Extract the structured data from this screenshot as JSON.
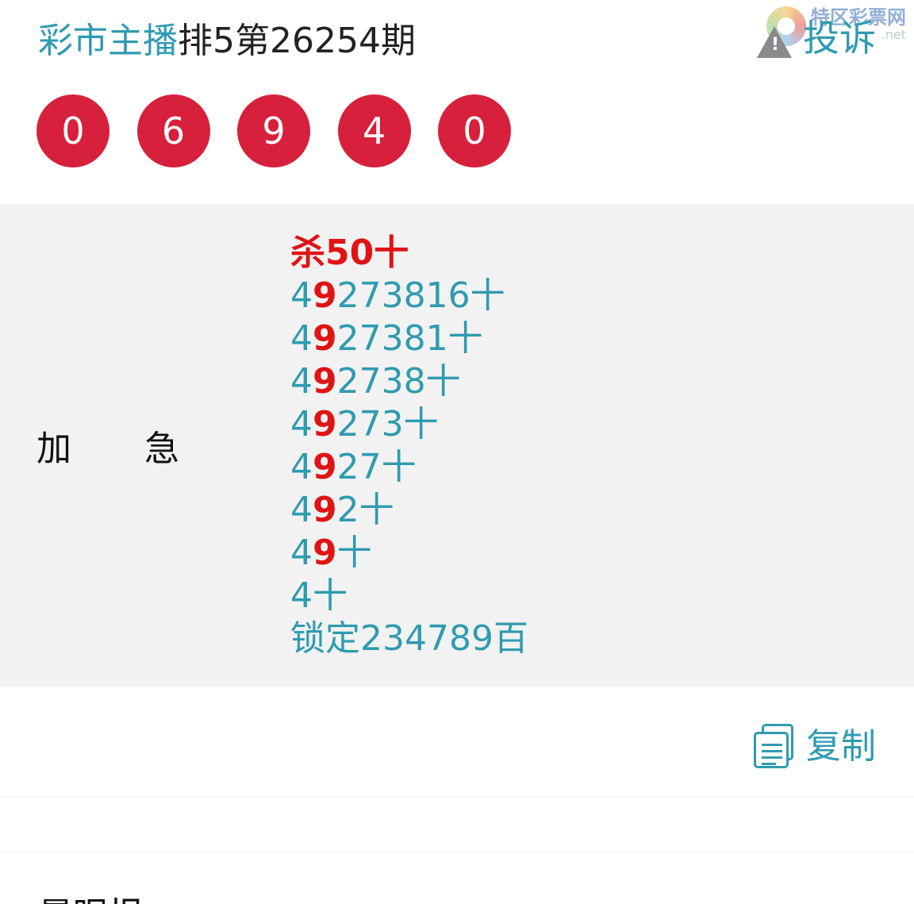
{
  "header": {
    "author": "彩市主播",
    "issue": "排5第26254期"
  },
  "complaint": {
    "icon": "warning-icon",
    "icon_glyph": "!",
    "label": "投诉"
  },
  "watermark": {
    "name": "特区彩票网",
    "url": ".net"
  },
  "balls": [
    "0",
    "6",
    "9",
    "4",
    "0"
  ],
  "panel": {
    "label_chars": [
      "加",
      "急"
    ],
    "kill_line": "杀50十",
    "lines": [
      {
        "a": "4",
        "b": "9",
        "c": "273816十"
      },
      {
        "a": "4",
        "b": "9",
        "c": "27381十"
      },
      {
        "a": "4",
        "b": "9",
        "c": "2738十"
      },
      {
        "a": "4",
        "b": "9",
        "c": "273十"
      },
      {
        "a": "4",
        "b": "9",
        "c": "27十"
      },
      {
        "a": "4",
        "b": "9",
        "c": "2十"
      },
      {
        "a": "4",
        "b": "9",
        "c": "十"
      }
    ],
    "single_line": "4十",
    "lock_line": "锁定234789百"
  },
  "copy": {
    "icon": "copy-icon",
    "label": "复制"
  },
  "footer": {
    "partial_title": "晨眠报"
  },
  "colors": {
    "accent": "#2f9bb0",
    "ball_red": "#d7203c",
    "highlight_red": "#e01414",
    "panel_bg": "#f2f2f2"
  }
}
